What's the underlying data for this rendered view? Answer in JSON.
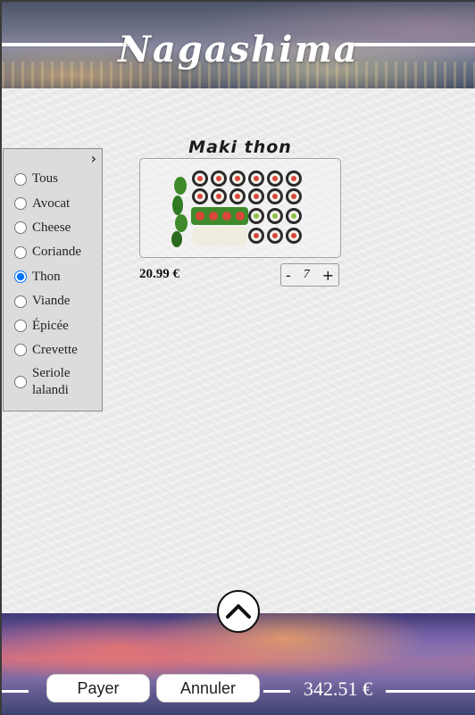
{
  "header": {
    "brand": "Nagashima"
  },
  "filters": {
    "toggle_icon": "chevron-right-icon",
    "items": [
      {
        "label": "Tous",
        "checked": false
      },
      {
        "label": "Avocat",
        "checked": false
      },
      {
        "label": "Cheese",
        "checked": false
      },
      {
        "label": "Coriande",
        "checked": false
      },
      {
        "label": "Thon",
        "checked": true
      },
      {
        "label": "Viande",
        "checked": false
      },
      {
        "label": "Épicée",
        "checked": false
      },
      {
        "label": "Crevette",
        "checked": false
      },
      {
        "label": "Seriole lalandi",
        "checked": false
      }
    ]
  },
  "product": {
    "name": "Maki thon",
    "price": "20.99 €",
    "quantity": "7",
    "decrement": "-",
    "increment": "+"
  },
  "footer": {
    "pay_label": "Payer",
    "cancel_label": "Annuler",
    "total": "342.51 €",
    "scroll_icon": "chevron-up-icon"
  },
  "colors": {
    "accent": "#ffffff",
    "radio_checked": "#1a73e8"
  }
}
